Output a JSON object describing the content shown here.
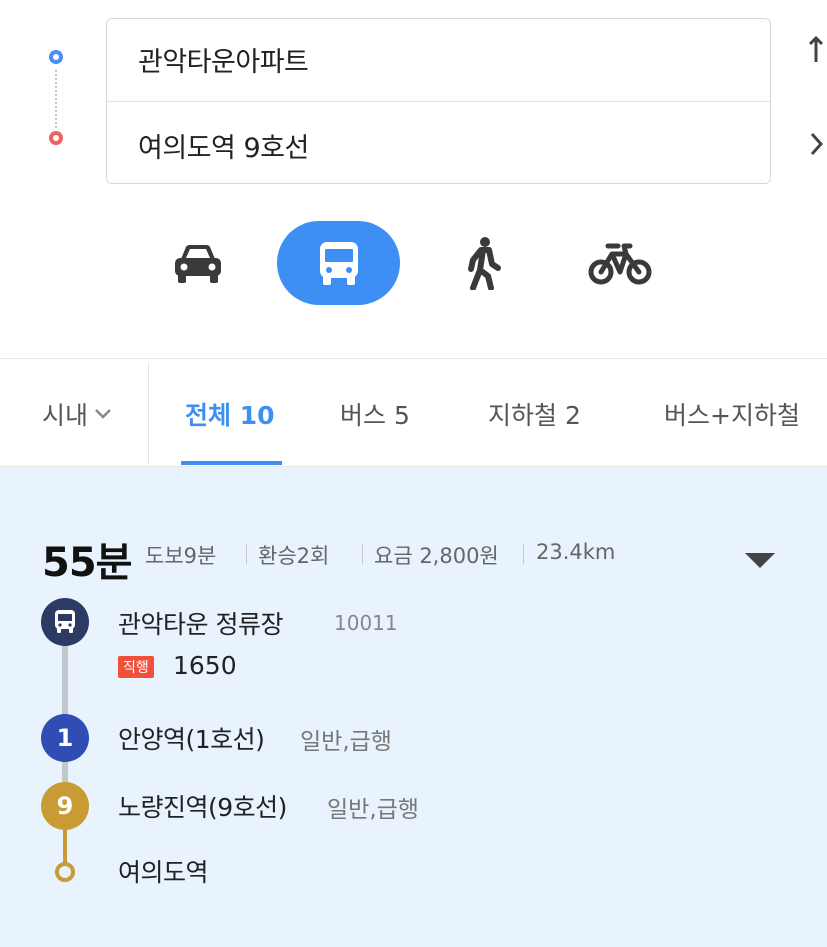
{
  "route": {
    "origin_value": "관악타운아파트",
    "destination_value": "여의도역 9호선"
  },
  "modes": [
    {
      "name": "car",
      "active": false
    },
    {
      "name": "transit",
      "active": true
    },
    {
      "name": "walk",
      "active": false
    },
    {
      "name": "bicycle",
      "active": false
    }
  ],
  "region_select": {
    "value": "시내"
  },
  "tabs": [
    {
      "label": "전체 10",
      "active": true
    },
    {
      "label": "버스 5",
      "active": false
    },
    {
      "label": "지하철 2",
      "active": false
    },
    {
      "label": "버스+지하철",
      "active": false
    }
  ],
  "result": {
    "duration": "55분",
    "walk": "도보9분",
    "transfers": "환승2회",
    "fare": "요금 2,800원",
    "distance": "23.4km",
    "steps": [
      {
        "type": "bus",
        "name": "관악타운 정류장",
        "stop_id": "10011",
        "badge": "직행",
        "route_number": "1650"
      },
      {
        "type": "subway",
        "line_label": "1",
        "name": "안양역(1호선)",
        "sub": "일반,급행",
        "color": "#2f4db2"
      },
      {
        "type": "subway",
        "line_label": "9",
        "name": "노량진역(9호선)",
        "sub": "일반,급행",
        "color": "#c89b34"
      },
      {
        "type": "arrival",
        "name": "여의도역"
      }
    ]
  },
  "colors": {
    "accent": "#3d8ff4",
    "origin": "#4b8df8",
    "destination": "#f0635f",
    "bus_stop": "#2c3a64",
    "express_badge": "#f04f3a",
    "card_bg": "#e8f3fe"
  }
}
